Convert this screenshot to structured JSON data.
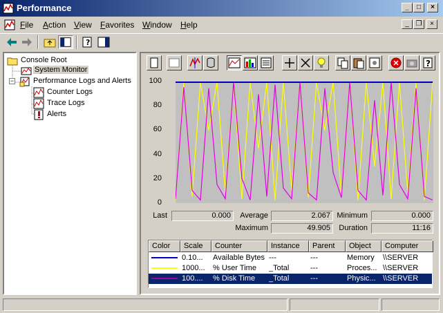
{
  "window": {
    "title": "Performance",
    "minimize": "_",
    "maximize": "□",
    "close": "×"
  },
  "menu": {
    "items": [
      "File",
      "Action",
      "View",
      "Favorites",
      "Window",
      "Help"
    ]
  },
  "tree": {
    "root": "Console Root",
    "system_monitor": "System Monitor",
    "perf_logs": "Performance Logs and Alerts",
    "counter_logs": "Counter Logs",
    "trace_logs": "Trace Logs",
    "alerts": "Alerts"
  },
  "stats": {
    "last_label": "Last",
    "last_value": "0.000",
    "average_label": "Average",
    "average_value": "2.067",
    "minimum_label": "Minimum",
    "minimum_value": "0.000",
    "maximum_label": "Maximum",
    "maximum_value": "49.905",
    "duration_label": "Duration",
    "duration_value": "11:16"
  },
  "legend": {
    "headers": [
      "Color",
      "Scale",
      "Counter",
      "Instance",
      "Parent",
      "Object",
      "Computer"
    ],
    "rows": [
      {
        "color": "#0000c0",
        "scale": "0.10...",
        "counter": "Available Bytes",
        "instance": "---",
        "parent": "---",
        "object": "Memory",
        "computer": "\\\\SERVER"
      },
      {
        "color": "#ffff00",
        "scale": "1000...",
        "counter": "% User Time",
        "instance": "_Total",
        "parent": "---",
        "object": "Proces...",
        "computer": "\\\\SERVER"
      },
      {
        "color": "#a000a0",
        "scale": "100....",
        "counter": "% Disk Time",
        "instance": "_Total",
        "parent": "---",
        "object": "Physic...",
        "computer": "\\\\SERVER"
      }
    ]
  },
  "chart_data": {
    "type": "line",
    "ylim": [
      0,
      100
    ],
    "yticks": [
      "100",
      "80",
      "60",
      "40",
      "20",
      "0"
    ],
    "grid": false,
    "series": [
      {
        "name": "Available Bytes",
        "color": "#0000c0",
        "values": [
          100,
          100,
          100,
          100,
          100,
          100,
          100,
          100
        ]
      },
      {
        "name": "% User Time",
        "color": "#ffff00",
        "values": [
          2,
          100,
          5,
          100,
          60,
          100,
          8,
          100,
          3,
          100,
          45,
          100,
          2,
          100,
          10,
          100,
          4,
          100,
          60,
          100,
          5,
          100,
          2,
          100,
          30,
          100,
          3,
          100,
          8,
          100,
          2,
          100
        ]
      },
      {
        "name": "% Disk Time",
        "color": "#e000e0",
        "values": [
          3,
          96,
          10,
          2,
          95,
          15,
          3,
          100,
          20,
          2,
          90,
          5,
          98,
          12,
          3,
          100,
          8,
          2,
          95,
          25,
          4,
          100,
          10,
          2,
          85,
          6,
          100,
          15,
          3,
          95,
          5,
          2
        ]
      }
    ]
  }
}
